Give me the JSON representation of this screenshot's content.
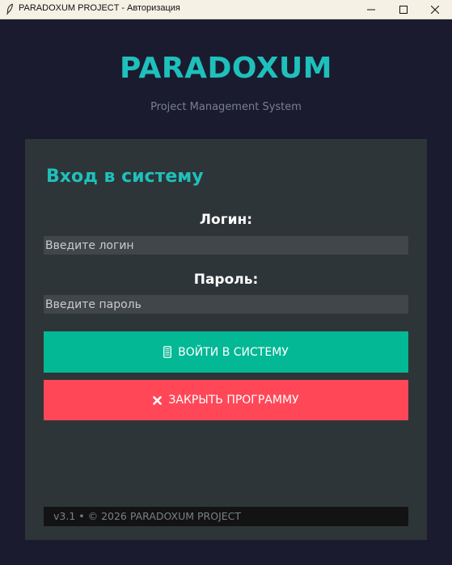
{
  "window": {
    "title": "PARADOXUM PROJECT - Авторизация",
    "icon": "feather-icon",
    "controls": [
      "minimize-icon",
      "maximize-icon",
      "close-icon"
    ]
  },
  "header": {
    "brand": "PARADOXUM",
    "subtitle": "Project Management System"
  },
  "login_card": {
    "title": "Вход в систему",
    "login_label": "Логин:",
    "login_placeholder": "Введите логин",
    "login_value": "",
    "password_label": "Пароль:",
    "password_placeholder": "Введите пароль",
    "password_value": "",
    "login_button": "ВОЙТИ В СИСТЕМУ",
    "login_button_icon": "phone-icon",
    "close_button": "ЗАКРЫТЬ ПРОГРАММУ",
    "close_button_icon": "cross-icon",
    "footer": "v3.1 • © 2026 PARADOXUM PROJECT"
  },
  "colors": {
    "background": "#1b1b30",
    "card": "#2d3538",
    "accent": "#1fc0bb",
    "login_button": "#02b895",
    "close_button": "#ff4757",
    "input": "#404649",
    "footer": "#131313"
  }
}
